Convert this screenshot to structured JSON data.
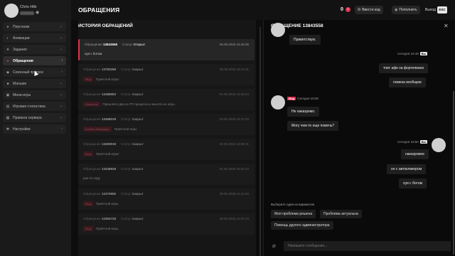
{
  "profile": {
    "name": "Chris Hiki"
  },
  "sidebar": {
    "items": [
      {
        "label": "Персонаж",
        "icon": "user-icon",
        "chevron": "⌄"
      },
      {
        "label": "Анимации",
        "icon": "animation-icon",
        "chevron": "⌄"
      },
      {
        "label": "Задания",
        "icon": "star-icon",
        "chevron": "⌄"
      },
      {
        "label": "Обращения",
        "icon": "report-icon",
        "chevron": "›",
        "active": true
      },
      {
        "label": "Сезонный пропуск",
        "icon": "pass-icon",
        "chevron": "›"
      },
      {
        "label": "Магазин",
        "icon": "shop-icon",
        "chevron": "⌄"
      },
      {
        "label": "Мини-игры",
        "icon": "gamepad-icon",
        "chevron": "⌄"
      },
      {
        "label": "Игровая статистика",
        "icon": "stats-icon",
        "chevron": "⌄"
      },
      {
        "label": "Правила сервера",
        "icon": "rules-icon",
        "chevron": "⌄"
      },
      {
        "label": "Настройки",
        "icon": "gear-icon",
        "chevron": "›"
      }
    ]
  },
  "header": {
    "title": "ОБРАЩЕНИЯ",
    "count": "0",
    "badge": "3",
    "enter_code": "Ввести код",
    "replenish": "Пополнить",
    "exit": "Выход",
    "esc": "ESC"
  },
  "history": {
    "title": "ИСТОРИЯ ОБРАЩЕНИЙ",
    "number_label": "Обращение",
    "status_label": "Статус",
    "tickets": [
      {
        "number": "13843558",
        "status": "Открыт",
        "date": "09.06.2026 15:49:36",
        "tag": "",
        "text": "хуи с ботом",
        "selected": true
      },
      {
        "number": "13783258",
        "status": "Закрыт",
        "date": "05.06.2026 16:11:31",
        "tag": "Мод",
        "text": "Приятной игры!"
      },
      {
        "number": "13488553",
        "status": "Закрыт",
        "date": "04.06.2026 14:09:14",
        "tag": "Аналитик",
        "text": "Пришлите два из РП процесса и выхоте из игры."
      },
      {
        "number": "13468018",
        "status": "Закрыт",
        "date": "03.06.2026 19:37:03",
        "tag": "Бизнес-Менеджер",
        "text": "Приятной игры."
      },
      {
        "number": "13400918",
        "status": "Закрыт",
        "date": "02.06.2026 12:58:31",
        "tag": "Мод",
        "text": "Приятной игры!"
      },
      {
        "number": "13348928",
        "status": "Закрыт",
        "date": "01.06.2026 18:33:10",
        "tag": "",
        "text": "рик по ходу"
      },
      {
        "number": "12370805",
        "status": "Закрыт",
        "date": "28.05.2026 14:12:40",
        "tag": "Мод",
        "text": "Приятной игры."
      },
      {
        "number": "12364728",
        "status": "Закрыт",
        "date": "28.05.2026 12:07:14",
        "tag": "Мод",
        "text": "Приятной игры."
      }
    ]
  },
  "chat": {
    "title": "ОБРАЩЕНИЕ 13843558",
    "messages": [
      {
        "side": "left",
        "text": "Приветствую."
      },
      {
        "side": "right",
        "time": "Сегодня 15:49",
        "tag": "Вы",
        "texts": [
          "тпит афк на фортепиано",
          "помеха вообщем"
        ]
      },
      {
        "side": "left",
        "time": "Сегодня 15:50",
        "tag": "Мод",
        "texts": [
          "Не наказуемо.",
          "Могу чем-то еще помочь?"
        ]
      },
      {
        "side": "right",
        "time": "Сегодня 15:50",
        "tag": "Вы",
        "texts": [
          "наказуемое",
          "он с автокликером",
          "хуи с ботом"
        ]
      }
    ],
    "choose_label": "Выберите один из вариантов",
    "options": [
      "Моя проблема решена",
      "Проблема актуальна",
      "Помощь другого администратора"
    ],
    "input_placeholder": "Напишите сообщение..."
  },
  "colors": {
    "accent": "#e0314f",
    "bg": "#0f0f10",
    "panel": "#161616"
  }
}
